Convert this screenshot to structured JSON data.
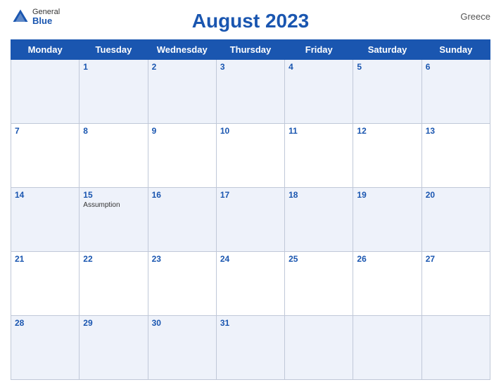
{
  "header": {
    "title": "August 2023",
    "country": "Greece",
    "logo": {
      "general": "General",
      "blue": "Blue"
    }
  },
  "weekdays": [
    "Monday",
    "Tuesday",
    "Wednesday",
    "Thursday",
    "Friday",
    "Saturday",
    "Sunday"
  ],
  "weeks": [
    [
      {
        "day": "",
        "event": ""
      },
      {
        "day": "1",
        "event": ""
      },
      {
        "day": "2",
        "event": ""
      },
      {
        "day": "3",
        "event": ""
      },
      {
        "day": "4",
        "event": ""
      },
      {
        "day": "5",
        "event": ""
      },
      {
        "day": "6",
        "event": ""
      }
    ],
    [
      {
        "day": "7",
        "event": ""
      },
      {
        "day": "8",
        "event": ""
      },
      {
        "day": "9",
        "event": ""
      },
      {
        "day": "10",
        "event": ""
      },
      {
        "day": "11",
        "event": ""
      },
      {
        "day": "12",
        "event": ""
      },
      {
        "day": "13",
        "event": ""
      }
    ],
    [
      {
        "day": "14",
        "event": ""
      },
      {
        "day": "15",
        "event": "Assumption"
      },
      {
        "day": "16",
        "event": ""
      },
      {
        "day": "17",
        "event": ""
      },
      {
        "day": "18",
        "event": ""
      },
      {
        "day": "19",
        "event": ""
      },
      {
        "day": "20",
        "event": ""
      }
    ],
    [
      {
        "day": "21",
        "event": ""
      },
      {
        "day": "22",
        "event": ""
      },
      {
        "day": "23",
        "event": ""
      },
      {
        "day": "24",
        "event": ""
      },
      {
        "day": "25",
        "event": ""
      },
      {
        "day": "26",
        "event": ""
      },
      {
        "day": "27",
        "event": ""
      }
    ],
    [
      {
        "day": "28",
        "event": ""
      },
      {
        "day": "29",
        "event": ""
      },
      {
        "day": "30",
        "event": ""
      },
      {
        "day": "31",
        "event": ""
      },
      {
        "day": "",
        "event": ""
      },
      {
        "day": "",
        "event": ""
      },
      {
        "day": "",
        "event": ""
      }
    ]
  ]
}
